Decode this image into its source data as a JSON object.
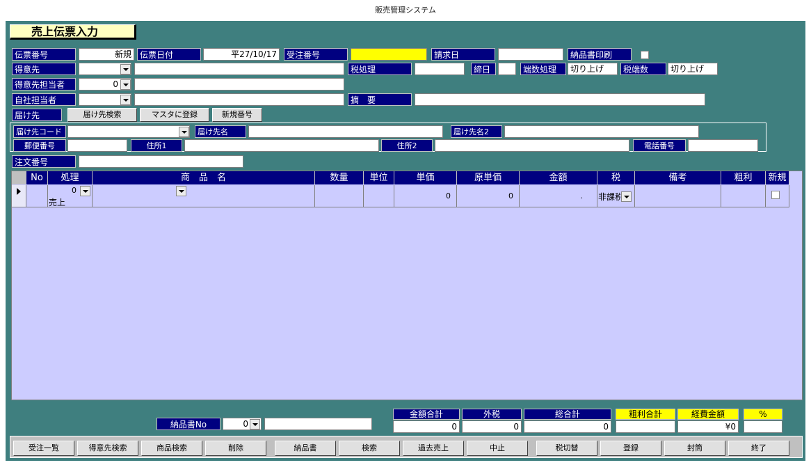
{
  "window": {
    "title": "販売管理システム"
  },
  "form_title": "売上伝票入力",
  "header": {
    "slip_no_label": "伝票番号",
    "slip_no_value": "新規",
    "slip_date_label": "伝票日付",
    "slip_date_value": "平27/10/17",
    "order_no_label": "受注番号",
    "order_no_value": "",
    "invoice_date_label": "請求日",
    "invoice_date_value": "",
    "delivery_print_label": "納品書印刷",
    "customer_label": "得意先",
    "customer_code": "",
    "customer_name": "",
    "tax_handling_label": "税処理",
    "tax_handling_value": "",
    "closing_day_label": "締日",
    "closing_day_value": "",
    "rounding_label": "端数処理",
    "rounding_value": "切り上げ",
    "tax_rounding_label": "税端数",
    "tax_rounding_value": "切り上げ",
    "customer_staff_label": "得意先担当者",
    "customer_staff_code": "0",
    "customer_staff_name": "",
    "own_staff_label": "自社担当者",
    "own_staff_code": "",
    "own_staff_name": "",
    "summary_label": "摘　要",
    "summary_value": "",
    "ship_to_label": "届け先",
    "ship_to_search_button": "届け先検索",
    "master_register_button": "マスタに登録",
    "new_number_button": "新規番号"
  },
  "ship_to": {
    "code_label": "届け先コード",
    "code_value": "",
    "name_label": "届け先名",
    "name_value": "",
    "name2_label": "届け先名2",
    "name2_value": "",
    "zip_label": "郵便番号",
    "zip_value": "",
    "address1_label": "住所1",
    "address1_value": "",
    "address2_label": "住所2",
    "address2_value": "",
    "phone_label": "電話番号",
    "phone_value": ""
  },
  "order_no_label": "注文番号",
  "order_no_value": "",
  "grid": {
    "columns": [
      "No",
      "処理",
      "商　品　名",
      "数量",
      "単位",
      "単価",
      "原単価",
      "金額",
      "税",
      "備考",
      "粗利",
      "新規"
    ],
    "rows": [
      {
        "process_code": "0",
        "process_name": "売上",
        "product": "",
        "qty": "",
        "unit": "",
        "price": "0",
        "cost": "0",
        "amount": ".",
        "tax": "非課税",
        "note": "",
        "profit": ""
      }
    ]
  },
  "footer": {
    "delivery_no_label": "納品書No",
    "delivery_no_value": "0",
    "delivery_no_text": "",
    "total_amount_label": "金額合計",
    "total_amount_value": "0",
    "outer_tax_label": "外税",
    "outer_tax_value": "0",
    "grand_total_label": "総合計",
    "grand_total_value": "0",
    "profit_total_label": "粗利合計",
    "profit_total_value": "",
    "expense_label": "経費金額",
    "expense_value": "¥0",
    "percent_label": "%",
    "percent_value": ""
  },
  "buttons": [
    "受注一覧",
    "得意先検索",
    "商品検索",
    "削除",
    "納品書",
    "検索",
    "過去売上",
    "中止",
    "税切替",
    "登録",
    "封筒",
    "終了"
  ],
  "colors": {
    "background": "#3f7f7f",
    "label": "#000080",
    "grid": "#ccccff",
    "highlight": "#ffff00"
  }
}
